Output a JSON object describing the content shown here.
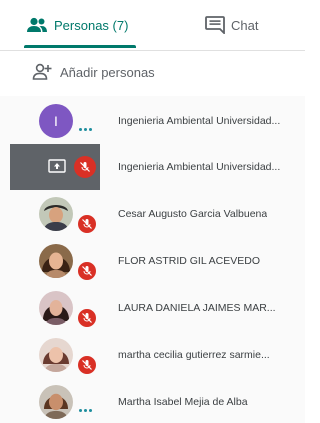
{
  "tabs": {
    "people_label": "Personas (7)",
    "chat_label": "Chat"
  },
  "add_people": {
    "label": "Añadir personas"
  },
  "participants": [
    {
      "name": "Ingenieria Ambiental Universidad...",
      "avatar_letter": "I",
      "avatar_color": "#7e57c2",
      "status": "speaking-dots"
    },
    {
      "name": "Ingenieria Ambiental Universidad...",
      "status": "presenting-muted"
    },
    {
      "name": "Cesar Augusto Garcia Valbuena",
      "status": "muted"
    },
    {
      "name": "FLOR ASTRID GIL ACEVEDO",
      "status": "muted"
    },
    {
      "name": "LAURA DANIELA JAIMES MAR...",
      "status": "muted"
    },
    {
      "name": "martha cecilia gutierrez sarmie...",
      "status": "muted"
    },
    {
      "name": "Martha Isabel Mejia de Alba",
      "status": "speaking-dots"
    }
  ],
  "colors": {
    "accent": "#00796b",
    "muted_badge": "#d93025",
    "presenting_tile": "#5f6368"
  }
}
